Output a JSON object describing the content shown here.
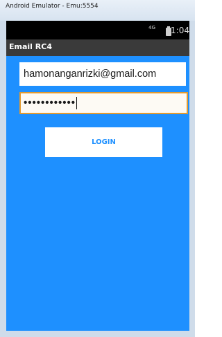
{
  "window": {
    "title": "Android Emulator - Emu:5554"
  },
  "statusbar": {
    "network": "4G",
    "time": "1:04"
  },
  "app": {
    "title": "Email RC4"
  },
  "form": {
    "email_value": "hamonanganrizki@gmail.com",
    "password_mask": "••••••••••••",
    "login_label": "LOGIN"
  },
  "colors": {
    "background": "#1e90ff",
    "actionbar": "#3a3a3a",
    "focus_border": "#e39a2f"
  },
  "icons": [
    "signal-icon",
    "battery-icon",
    "text-caret-icon"
  ]
}
